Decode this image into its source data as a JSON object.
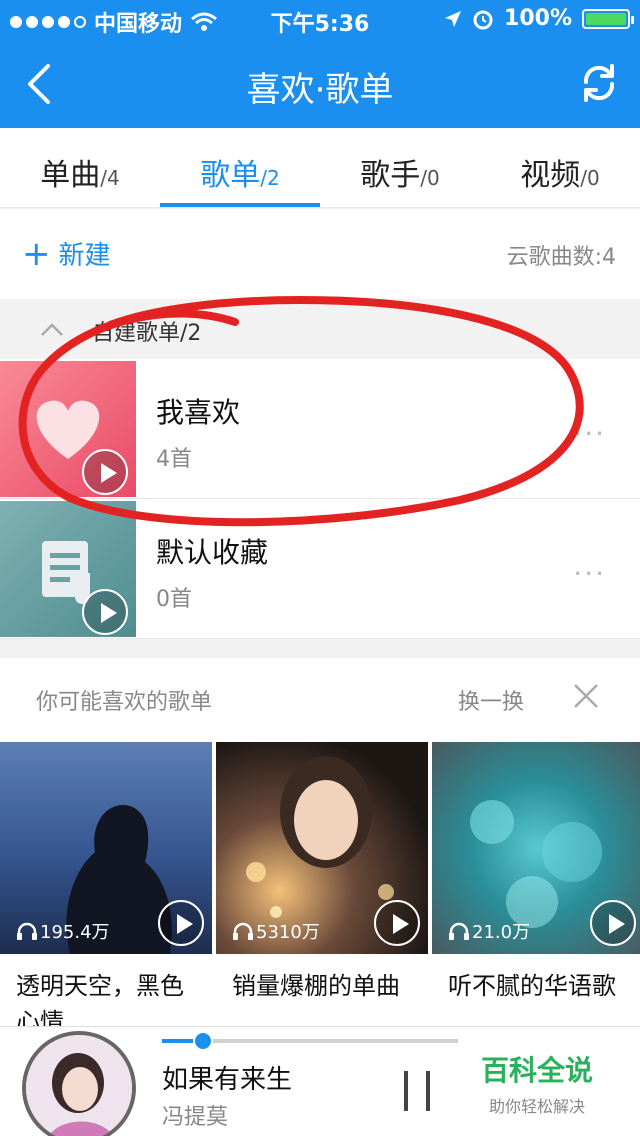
{
  "status": {
    "carrier": "中国移动",
    "time": "下午5:36",
    "battery": "100%",
    "battery_level": 1.0
  },
  "nav": {
    "title": "喜欢·歌单",
    "back_icon": "chevron-left-icon",
    "refresh_icon": "refresh-icon"
  },
  "tabs": [
    {
      "label": "单曲",
      "count": "/4"
    },
    {
      "label": "歌单",
      "count": "/2",
      "active": true
    },
    {
      "label": "歌手",
      "count": "/0"
    },
    {
      "label": "视频",
      "count": "/0"
    }
  ],
  "actions": {
    "new_label": "新建",
    "cloud_count": "云歌曲数:4"
  },
  "section": {
    "label": "自建歌单/2"
  },
  "playlists": [
    {
      "name": "我喜欢",
      "count": "4首",
      "more": "···",
      "icon": "heart-icon"
    },
    {
      "name": "默认收藏",
      "count": "0首",
      "more": "···",
      "icon": "music-list-icon"
    }
  ],
  "recommend": {
    "title": "你可能喜欢的歌单",
    "swap": "换一换",
    "cards": [
      {
        "plays": "195.4万",
        "title": "透明天空，黑色心情"
      },
      {
        "plays": "5310万",
        "title": "销量爆棚的单曲"
      },
      {
        "plays": "21.0万",
        "title": "听不腻的华语歌"
      }
    ]
  },
  "player": {
    "song": "如果有来生",
    "artist": "冯提莫",
    "progress": 0.14
  },
  "watermark": {
    "main": "百科全说",
    "sub": "助你轻松解决"
  },
  "colors": {
    "accent": "#1a8ff0",
    "annotation": "#e32222"
  }
}
